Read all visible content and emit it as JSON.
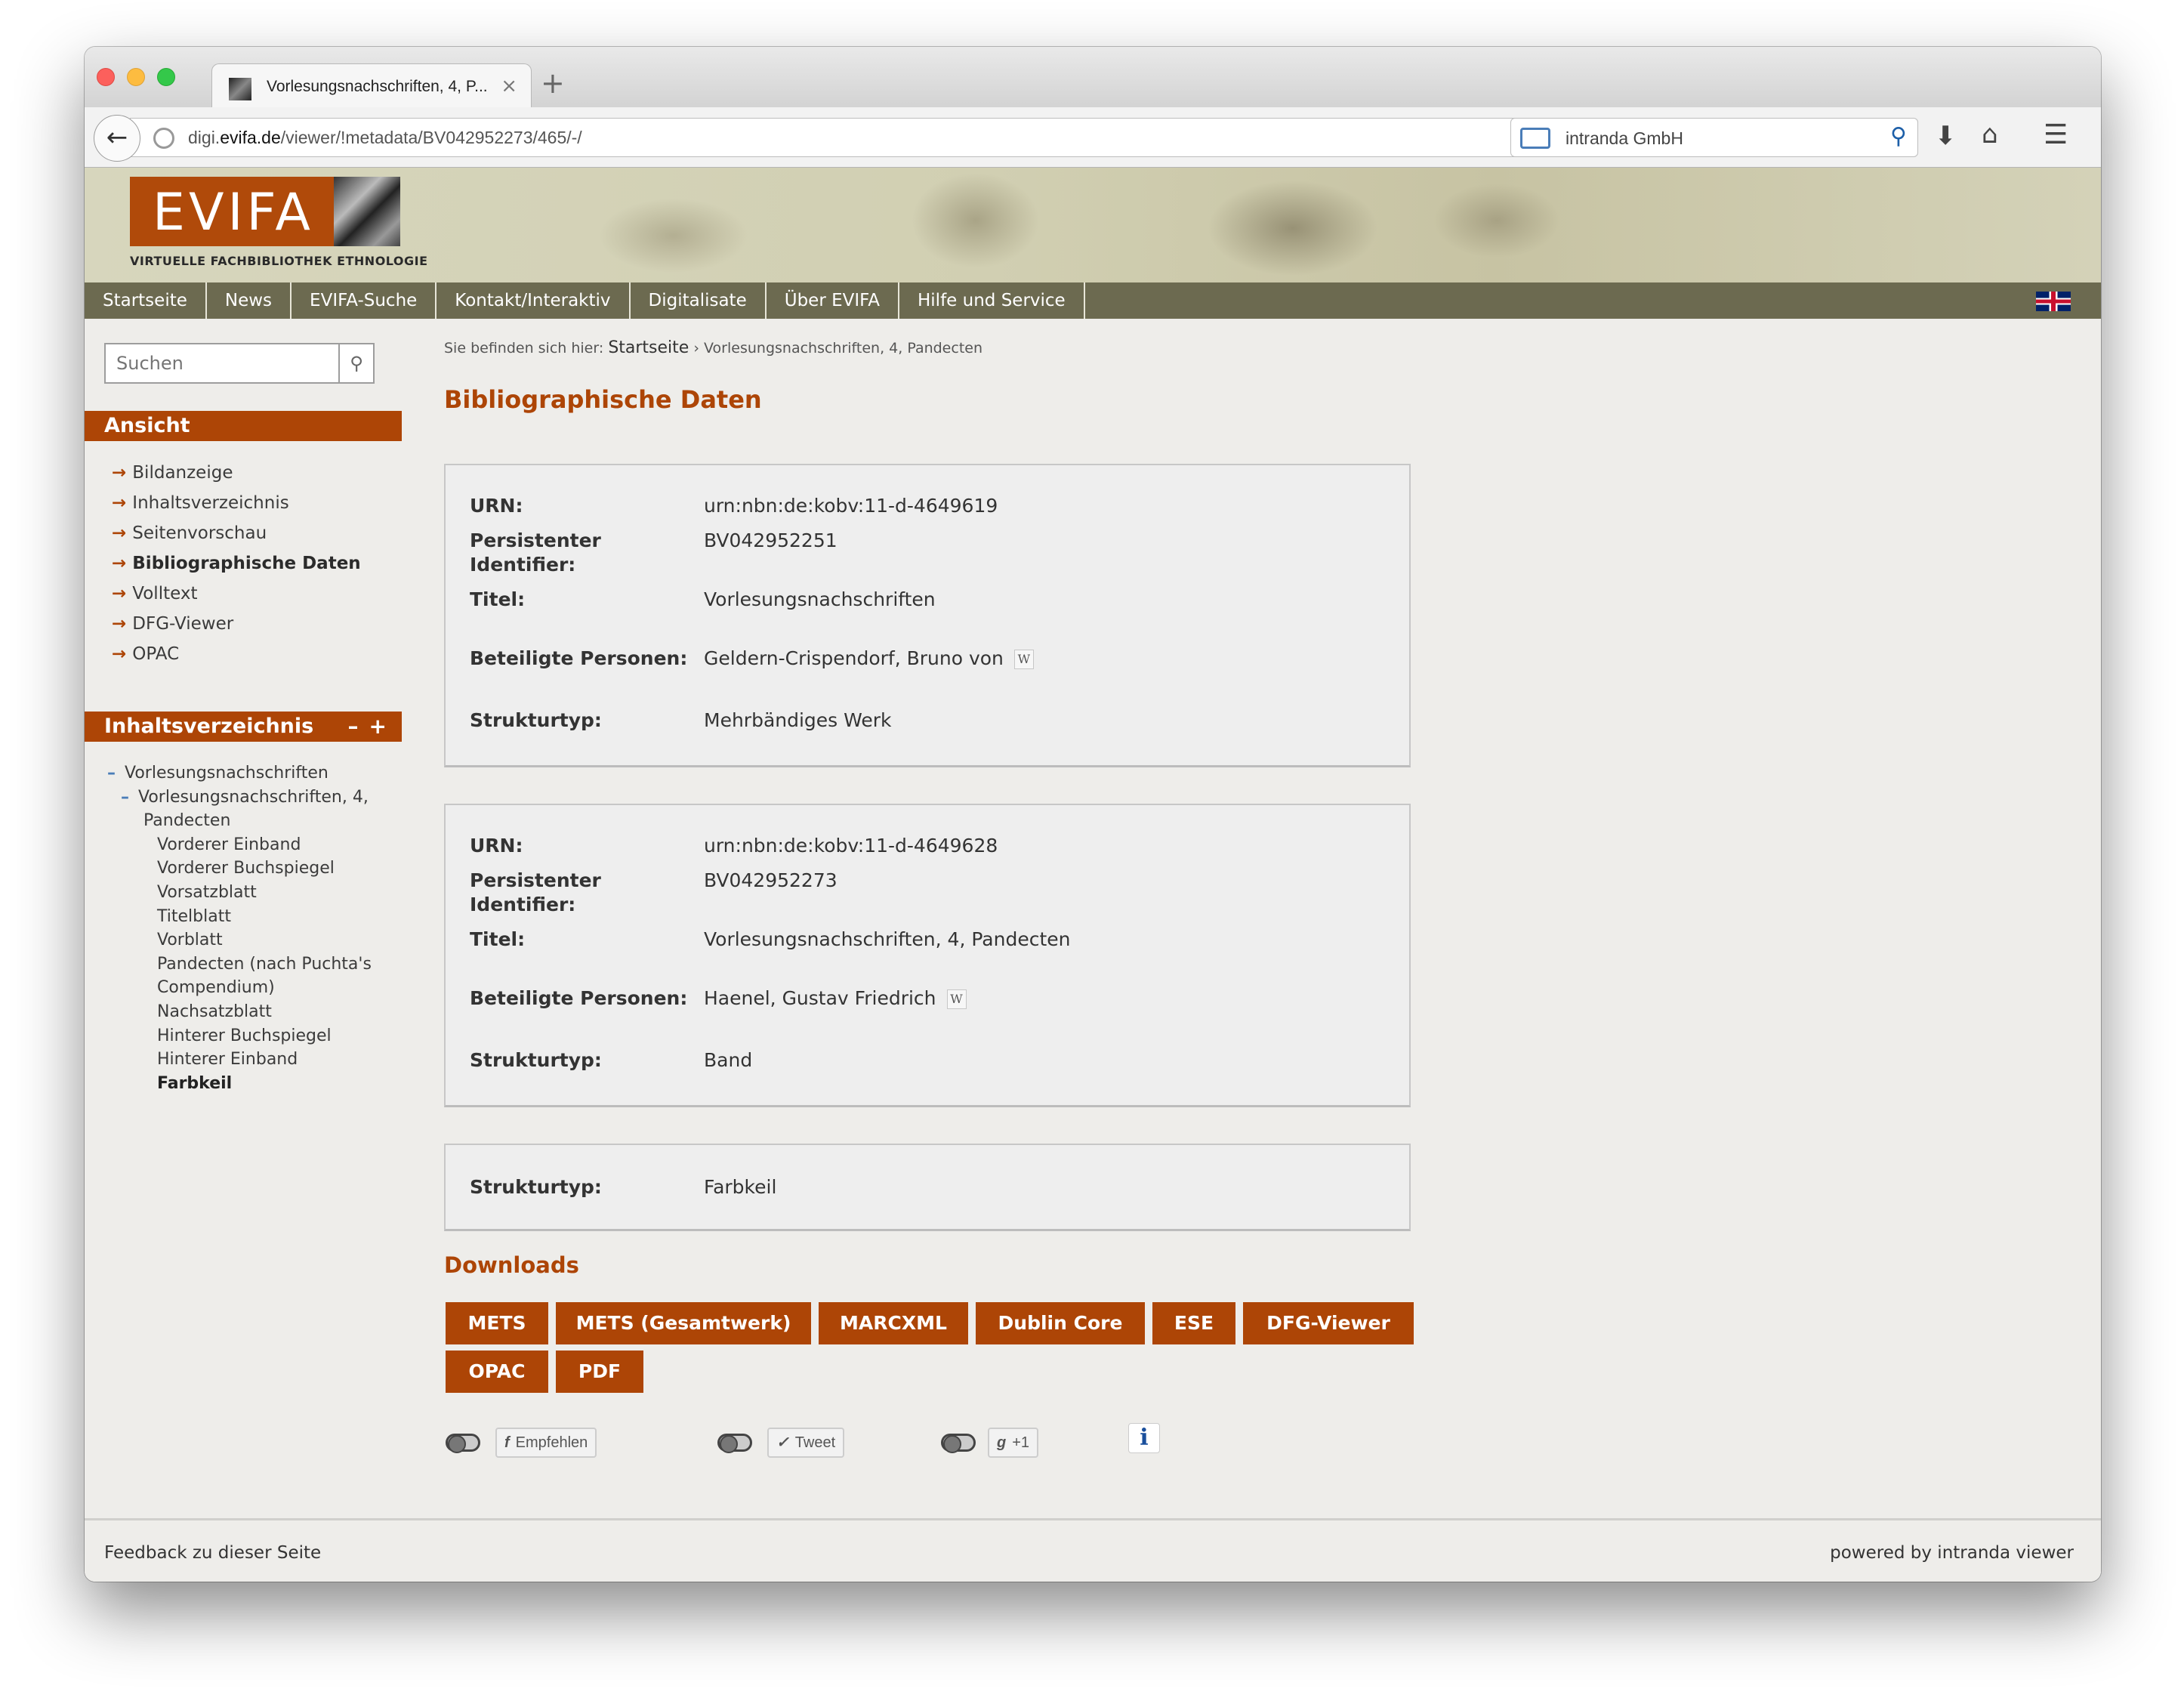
{
  "browser": {
    "tab_title": "Vorlesungsnachschriften, 4, P...",
    "tab_close": "×",
    "new_tab": "+",
    "url_prefix": "digi.",
    "url_domain": "evifa.de",
    "url_path": "/viewer/!metadata/BV042952273/465/-/",
    "search_engine_label": "intranda GmbH",
    "icons": [
      "back-icon",
      "globe-icon",
      "reload-icon",
      "search-icon",
      "download-icon",
      "home-icon",
      "menu-icon"
    ]
  },
  "banner": {
    "logo_text": "EVIFA",
    "logo_subtitle": "VIRTUELLE  FACHBIBLIOTHEK  ETHNOLOGIE"
  },
  "mainnav": {
    "items": [
      "Startseite",
      "News",
      "EVIFA-Suche",
      "Kontakt/Interaktiv",
      "Digitalisate",
      "Über EVIFA",
      "Hilfe und Service"
    ]
  },
  "sidebar": {
    "search_placeholder": "Suchen",
    "ansicht_title": "Ansicht",
    "ansicht_items": [
      {
        "label": "Bildanzeige"
      },
      {
        "label": "Inhaltsverzeichnis"
      },
      {
        "label": "Seitenvorschau"
      },
      {
        "label": "Bibliographische Daten"
      },
      {
        "label": "Volltext"
      },
      {
        "label": "DFG-Viewer"
      },
      {
        "label": "OPAC"
      }
    ],
    "toc_title": "Inhaltsverzeichnis",
    "toc_controls": "–+",
    "toc": {
      "root": "Vorlesungsnachschriften",
      "volume_line1": "Vorlesungsnachschriften, 4,",
      "volume_line2": "Pandecten",
      "children": [
        "Vorderer Einband",
        "Vorderer Buchspiegel",
        "Vorsatzblatt",
        "Titelblatt",
        "Vorblatt",
        "Pandecten (nach Puchta's",
        "Compendium)",
        "Nachsatzblatt",
        "Hinterer Buchspiegel",
        "Hinterer Einband",
        "Farbkeil"
      ]
    }
  },
  "main": {
    "breadcrumb_prefix": "Sie befinden sich hier:",
    "breadcrumb_home": "Startseite",
    "breadcrumb_sep": "›",
    "breadcrumb_current": "Vorlesungsnachschriften, 4, Pandecten",
    "title": "Bibliographische Daten",
    "labels": {
      "urn": "URN:",
      "pid_line1": "Persistenter",
      "pid_line2": "Identifier:",
      "title": "Titel:",
      "persons": "Beteiligte Personen:",
      "structtype": "Strukturtyp:"
    },
    "record1": {
      "urn": "urn:nbn:de:kobv:11-d-4649619",
      "pid": "BV042952251",
      "title": "Vorlesungsnachschriften",
      "person": "Geldern-Crispendorf, Bruno von",
      "structtype": "Mehrbändiges Werk"
    },
    "record2": {
      "urn": "urn:nbn:de:kobv:11-d-4649628",
      "pid": "BV042952273",
      "title": "Vorlesungsnachschriften, 4, Pandecten",
      "person": "Haenel, Gustav Friedrich",
      "structtype": "Band"
    },
    "record3": {
      "structtype": "Farbkeil"
    },
    "wiki_glyph": "W",
    "downloads_title": "Downloads",
    "downloads": [
      "METS",
      "METS (Gesamtwerk)",
      "MARCXML",
      "Dublin Core",
      "ESE",
      "DFG-Viewer",
      "OPAC",
      "PDF"
    ],
    "social": {
      "facebook_icon": "f",
      "facebook_label": "Empfehlen",
      "twitter_icon": "✓",
      "twitter_label": "Tweet",
      "gplus_icon": "g",
      "gplus_label": "+1",
      "info": "i"
    }
  },
  "footer": {
    "left": "Feedback zu dieser Seite",
    "right": "powered by intranda viewer"
  },
  "colors": {
    "accent": "#ad4506",
    "nav_bg": "#6c6a50",
    "page_bg": "#eeedea"
  }
}
